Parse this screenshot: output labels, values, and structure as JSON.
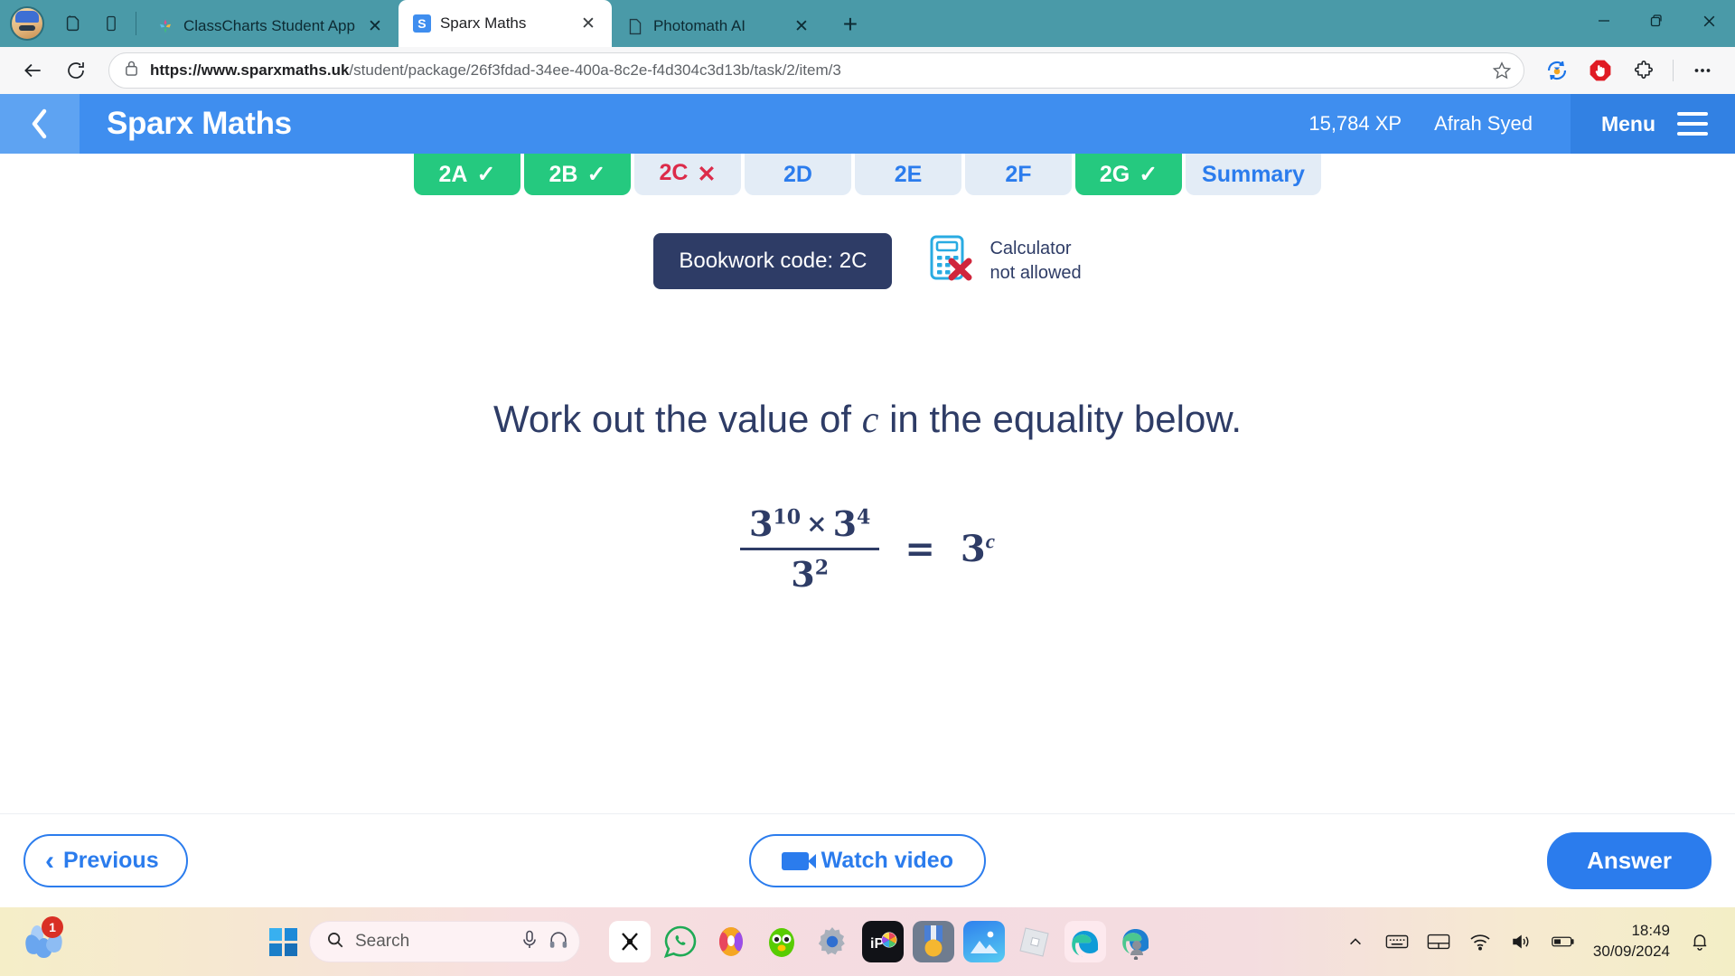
{
  "browser": {
    "tabs": [
      {
        "title": "ClassCharts Student App",
        "favicon": "classcharts-icon",
        "active": false
      },
      {
        "title": "Sparx Maths",
        "favicon": "sparx-icon",
        "active": true
      },
      {
        "title": "Photomath AI",
        "favicon": "document-icon",
        "active": false
      }
    ],
    "new_tab_label": "+",
    "window_controls": {
      "minimize": "–",
      "restore": "❐",
      "close": "✕"
    },
    "url_prefix": "https://www.sparxmaths.uk",
    "url_suffix": "/student/package/26f3fdad-34ee-400a-8c2e-f4d304c3d13b/task/2/item/3",
    "back_label": "back-arrow",
    "reload_label": "reload",
    "toolbar_icons": [
      "star-icon",
      "sync-extension-icon",
      "adblock-icon",
      "extensions-puzzle-icon",
      "more-options-icon"
    ]
  },
  "sparx": {
    "back_label": "‹",
    "logo": "Sparx Maths",
    "xp": "15,784 XP",
    "user": "Afrah Syed",
    "menu_label": "Menu",
    "task_tabs": [
      {
        "label": "2A",
        "state": "done",
        "mark": "✓"
      },
      {
        "label": "2B",
        "state": "done",
        "mark": "✓"
      },
      {
        "label": "2C",
        "state": "current",
        "mark": "✕"
      },
      {
        "label": "2D",
        "state": "todo",
        "mark": ""
      },
      {
        "label": "2E",
        "state": "todo",
        "mark": ""
      },
      {
        "label": "2F",
        "state": "todo",
        "mark": ""
      },
      {
        "label": "2G",
        "state": "done",
        "mark": "✓"
      },
      {
        "label": "Summary",
        "state": "summary",
        "mark": ""
      }
    ],
    "bookwork_code": "Bookwork code: 2C",
    "calculator_line1": "Calculator",
    "calculator_line2": "not allowed",
    "question_pre": "Work out the value of",
    "question_var": "c",
    "question_post": "in the equality below.",
    "equation": {
      "numerator_base_1": "3",
      "numerator_exp_1": "10",
      "times": "×",
      "numerator_base_2": "3",
      "numerator_exp_2": "4",
      "denominator_base": "3",
      "denominator_exp": "2",
      "equals": "=",
      "rhs_base": "3",
      "rhs_exp": "c"
    },
    "previous_label": "Previous",
    "previous_chevron": "‹",
    "watch_video_label": "Watch video",
    "answer_label": "Answer",
    "colors": {
      "header_blue": "#3f8eef",
      "done_green": "#25c97f",
      "todo_blue_bg": "#e3ecf6",
      "current_red": "#dc2b4a",
      "bookwork_navy": "#2e3c66",
      "accent_blue": "#2b7ced"
    }
  },
  "taskbar": {
    "notification_badge": "1",
    "search_placeholder": "Search",
    "apps": [
      {
        "name": "capcut-icon",
        "glyph": "✄"
      },
      {
        "name": "whatsapp-icon",
        "glyph": ""
      },
      {
        "name": "opera-gx-icon",
        "glyph": ""
      },
      {
        "name": "duolingo-icon",
        "glyph": ""
      },
      {
        "name": "settings-gear-icon",
        "glyph": ""
      },
      {
        "name": "photomath-icon",
        "glyph": "iP"
      },
      {
        "name": "medal-icon",
        "glyph": ""
      },
      {
        "name": "photos-icon",
        "glyph": ""
      },
      {
        "name": "roblox-icon",
        "glyph": ""
      },
      {
        "name": "edge-browser-icon",
        "glyph": ""
      },
      {
        "name": "edge-profile-icon",
        "glyph": ""
      }
    ],
    "tray": [
      "chevron-up-icon",
      "keyboard-icon",
      "touchpad-icon",
      "wifi-icon",
      "volume-icon",
      "battery-icon"
    ],
    "time": "18:49",
    "date": "30/09/2024",
    "bell": "notifications-bell-icon"
  }
}
